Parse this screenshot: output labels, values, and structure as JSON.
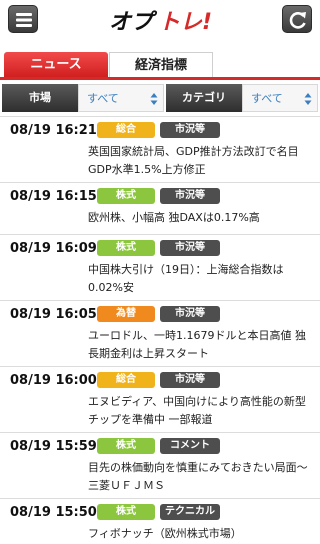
{
  "app": {
    "logo_text": "オプトレ!"
  },
  "tabs": [
    {
      "label": "ニュース"
    },
    {
      "label": "経済指標"
    }
  ],
  "filter": {
    "market_label": "市場",
    "market_value": "すべて",
    "category_label": "カテゴリ",
    "category_value": "すべて"
  },
  "colors": {
    "総合": "#f0b31c",
    "株式": "#8cc63e",
    "為替": "#f08a1e"
  },
  "news": [
    {
      "time": "08/19 16:21",
      "type": "総合",
      "category": "市況等",
      "headline": "英国国家統計局、GDP推計方法改訂で名目GDP水準1.5%上方修正"
    },
    {
      "time": "08/19 16:15",
      "type": "株式",
      "category": "市況等",
      "headline": "欧州株、小幅高 独DAXは0.17%高"
    },
    {
      "time": "08/19 16:09",
      "type": "株式",
      "category": "市況等",
      "headline": "中国株大引け（19日）：上海総合指数は0.02%安"
    },
    {
      "time": "08/19 16:05",
      "type": "為替",
      "category": "市況等",
      "headline": "ユーロドル、一時1.1679ドルと本日高値 独長期金利は上昇スタート"
    },
    {
      "time": "08/19 16:00",
      "type": "総合",
      "category": "市況等",
      "headline": "エヌビディア、中国向けにより高性能の新型チップを準備中 一部報道"
    },
    {
      "time": "08/19 15:59",
      "type": "株式",
      "category": "コメント",
      "headline": "目先の株価動向を慎重にみておきたい局面～三菱ＵＦＪＭＳ"
    },
    {
      "time": "08/19 15:50",
      "type": "株式",
      "category": "テクニカル",
      "headline": "フィボナッチ（欧州株式市場）"
    }
  ]
}
